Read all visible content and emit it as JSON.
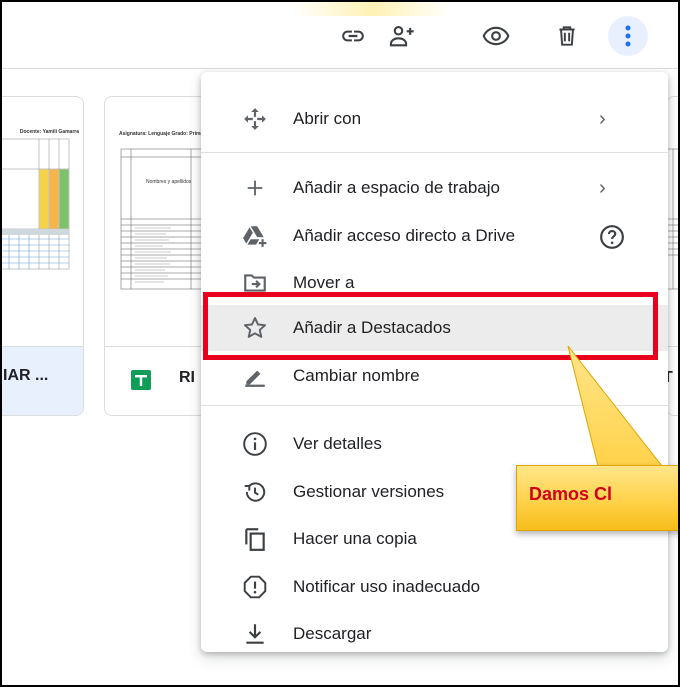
{
  "toolbar": {
    "icons": [
      "link-icon",
      "share-icon",
      "preview-icon",
      "delete-icon",
      "more-vert-icon"
    ],
    "accent": "#1a73e8"
  },
  "cards": {
    "card1_title": "IAR ...",
    "card2_title": "RI",
    "card3_title": "T",
    "card1_thumb_header": "Docente: Yamili Gamarra",
    "card2_thumb_header": "Asignatura: Lenguaje    Grado: Primero",
    "card2_thumb_col": "Nombres y apellidos"
  },
  "menu": {
    "items": [
      {
        "label": "Abrir con",
        "icon": "open-with-icon",
        "submenu": true
      },
      {
        "label": "Añadir a espacio de trabajo",
        "icon": "add-icon",
        "submenu": true
      },
      {
        "label": "Añadir acceso directo a Drive",
        "icon": "drive-shortcut-icon",
        "help": true
      },
      {
        "label": "Mover a",
        "icon": "move-to-folder-icon"
      },
      {
        "label": "Añadir a Destacados",
        "icon": "star-icon",
        "highlighted": true
      },
      {
        "label": "Cambiar nombre",
        "icon": "rename-icon"
      },
      {
        "label": "Ver detalles",
        "icon": "info-icon"
      },
      {
        "label": "Gestionar versiones",
        "icon": "history-icon"
      },
      {
        "label": "Hacer una copia",
        "icon": "copy-icon"
      },
      {
        "label": "Notificar uso inadecuado",
        "icon": "report-icon"
      },
      {
        "label": "Descargar",
        "icon": "download-icon"
      }
    ],
    "submenu_arrow": "›"
  },
  "annotation": {
    "callout_text": "Damos Cl",
    "highlight_color": "#e8001c",
    "callout_text_color": "#d0021b"
  }
}
